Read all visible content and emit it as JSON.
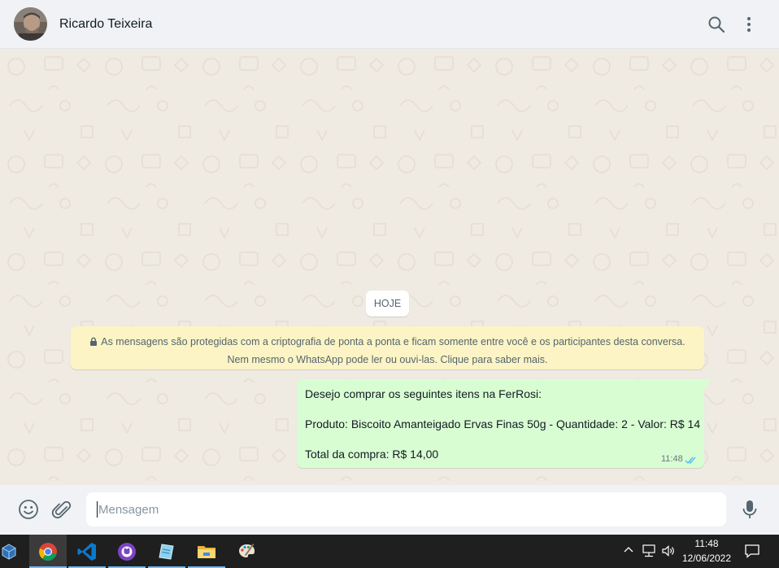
{
  "header": {
    "contact_name": "Ricardo Teixeira",
    "icons": [
      "search-icon",
      "menu-icon"
    ]
  },
  "chat": {
    "date_chip": "HOJE",
    "encryption_notice": {
      "line1": "As mensagens são protegidas com a criptografia de ponta a ponta e ficam somente entre você e os participantes desta conversa.",
      "line2": "Nem mesmo o WhatsApp pode ler ou ouvi-las. Clique para saber mais."
    },
    "message": {
      "line1": "Desejo comprar os seguintes itens na FerRosi:",
      "line2": "Produto: Biscoito Amanteigado Ervas Finas 50g - Quantidade: 2 - Valor: R$ 14",
      "line3": "Total da compra: R$ 14,00",
      "time": "11:48",
      "status": "read"
    }
  },
  "composer": {
    "placeholder": "Mensagem",
    "icons": [
      "emoji-icon",
      "attach-icon",
      "mic-icon"
    ]
  },
  "taskbar": {
    "apps": [
      "virtualbox",
      "chrome",
      "vscode",
      "github-desktop",
      "notepad",
      "file-explorer",
      "paint"
    ],
    "clock_time": "11:48",
    "clock_date": "12/06/2022"
  },
  "colors": {
    "bubble_out": "#d9fdd3",
    "notice_bg": "#fdf4c5",
    "chat_bg": "#efeae2",
    "header_bg": "#f0f2f5",
    "read_ticks": "#53bdeb"
  }
}
